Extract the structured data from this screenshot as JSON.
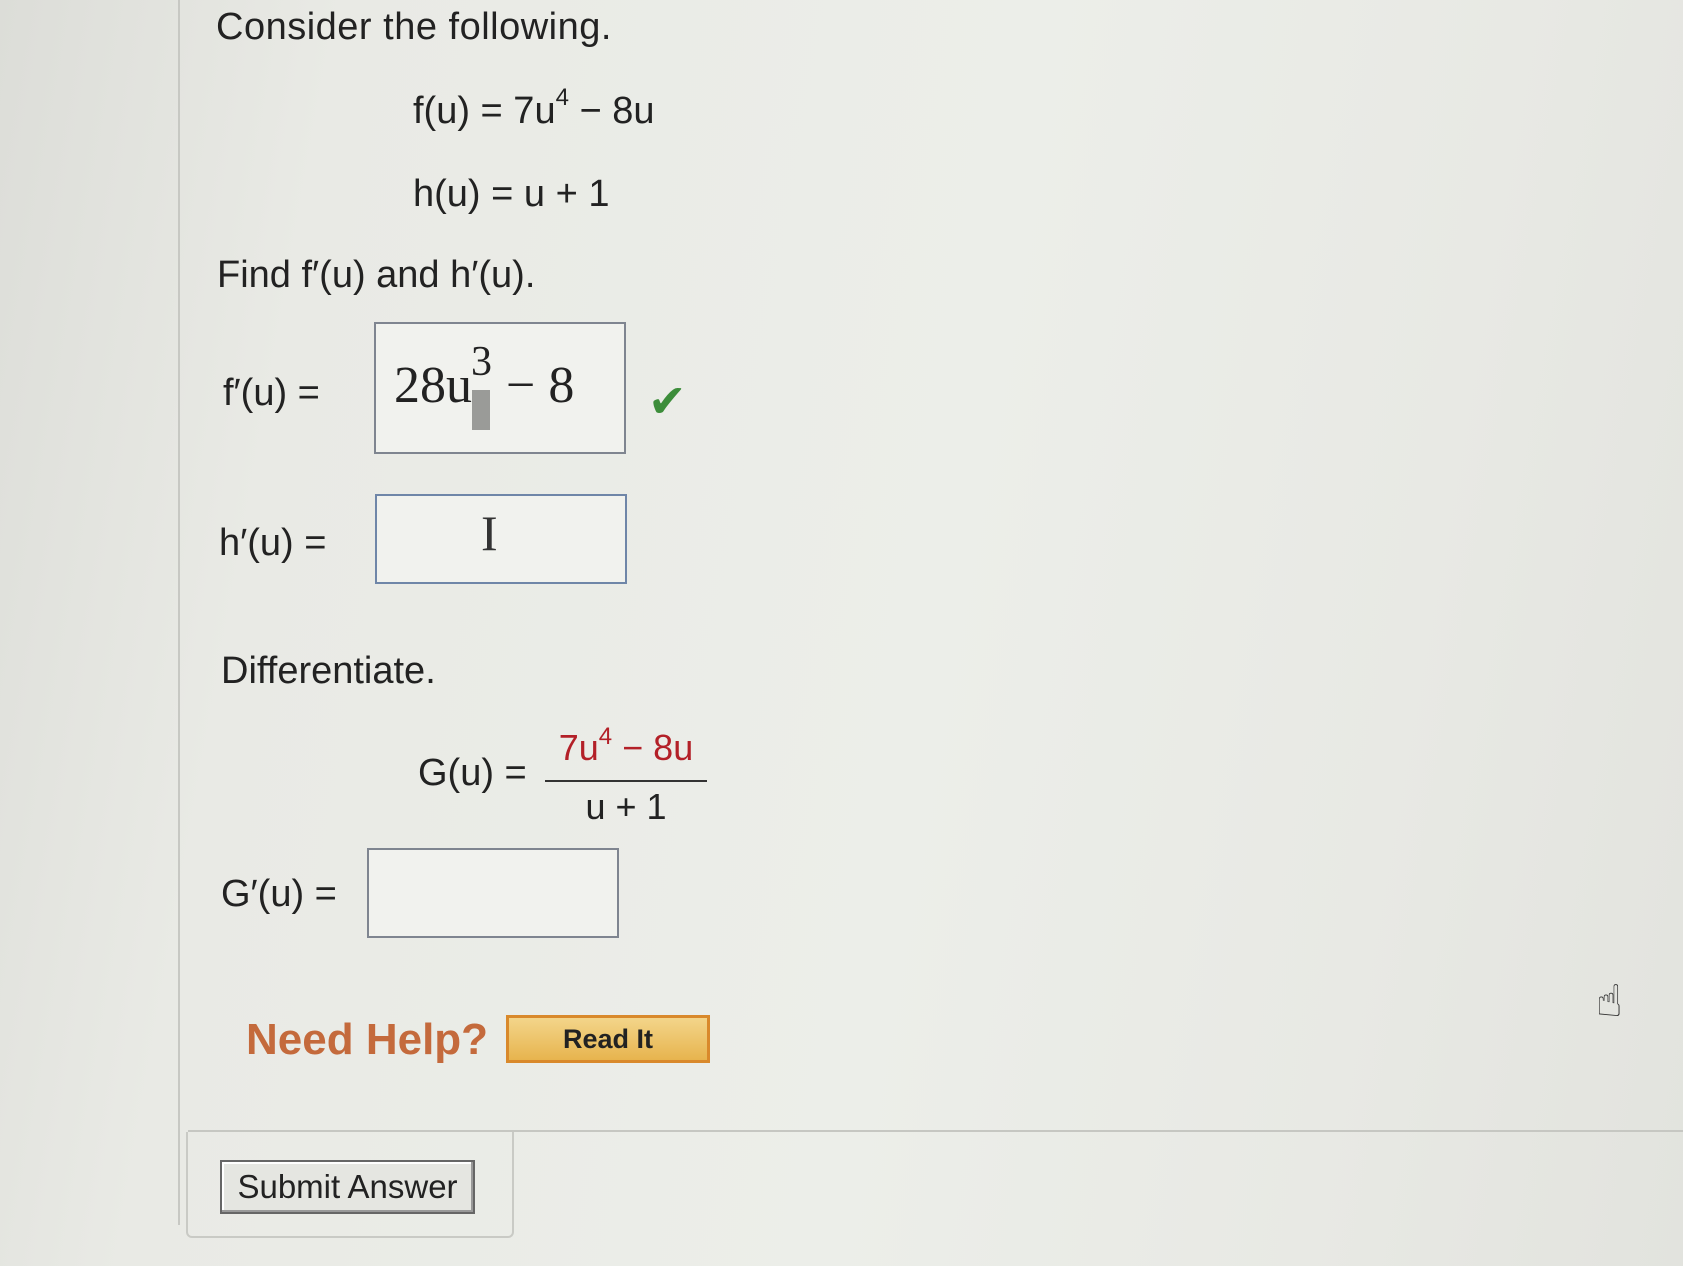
{
  "heading": "Consider the following.",
  "given": {
    "f_def": {
      "lhs": "f(u) = 7u",
      "exp": "4",
      "rest": " − 8u"
    },
    "h_def": "h(u) = u + 1"
  },
  "find_prompt": "Find f′(u) and h′(u).",
  "f_prime": {
    "label": "f′(u) =",
    "answer_coeff": "28u",
    "answer_exp": "3",
    "answer_rest": "− 8",
    "check": "✔"
  },
  "h_prime": {
    "label": "h′(u) =",
    "cursor": "I"
  },
  "differentiate_prompt": "Differentiate.",
  "G_def": {
    "lhs": "G(u) =",
    "numerator_a": "7u",
    "numerator_exp": "4",
    "numerator_b": " − 8u",
    "denominator": "u + 1"
  },
  "G_prime": {
    "label": "G′(u) ="
  },
  "help": {
    "need_help": "Need Help?",
    "read_it": "Read It"
  },
  "submit_label": "Submit Answer",
  "colors": {
    "highlight_red": "#b32028",
    "check_green": "#3c8d3a",
    "help_orange": "#c46a3c",
    "read_it_fill": "#e7b44e"
  }
}
